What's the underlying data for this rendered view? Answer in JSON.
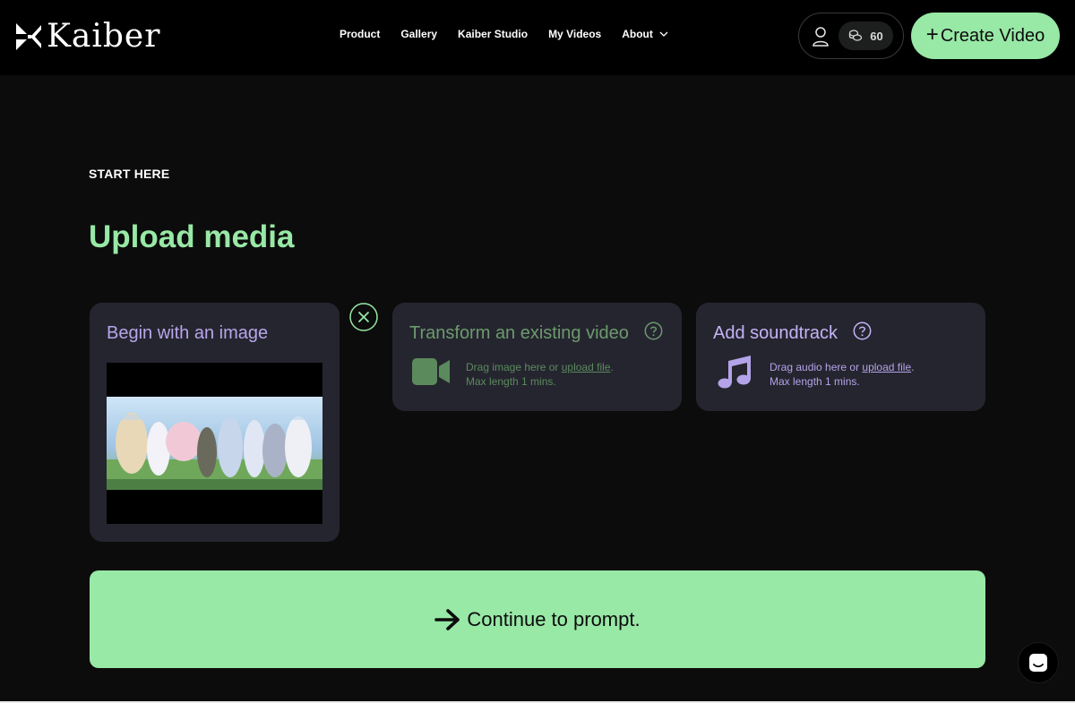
{
  "brand": {
    "name": "Kaiber"
  },
  "nav": {
    "items": [
      "Product",
      "Gallery",
      "Kaiber Studio",
      "My Videos",
      "About"
    ]
  },
  "account": {
    "credits": "60"
  },
  "header": {
    "create_label": "Create Video",
    "create_plus": "+"
  },
  "main": {
    "eyebrow": "START HERE",
    "heading": "Upload media"
  },
  "cards": {
    "image": {
      "title": "Begin with an image"
    },
    "video": {
      "title": "Transform an existing video",
      "drag_text": "Drag image here or",
      "upload_link": "upload file",
      "period": ".",
      "max_length": "Max length 1 mins."
    },
    "sound": {
      "title": "Add soundtrack",
      "drag_text": "Drag audio here or",
      "upload_link": "upload file",
      "period": ".",
      "max_length": "Max length 1 mins."
    }
  },
  "continue": {
    "label": "Continue to prompt."
  },
  "colors": {
    "accent_green": "#98e8a6",
    "accent_purple": "#b7a6ea",
    "card_bg": "#25252f",
    "background": "#0c0c0c"
  },
  "icons": {
    "logo": "kaiber-logo-icon",
    "user": "user-icon",
    "credits": "coins-icon",
    "chevron": "chevron-down-icon",
    "remove": "close-circle-icon",
    "help": "question-circle-icon",
    "video": "video-camera-icon",
    "music": "music-note-icon",
    "arrow": "arrow-right-icon",
    "chat": "chat-icon"
  }
}
